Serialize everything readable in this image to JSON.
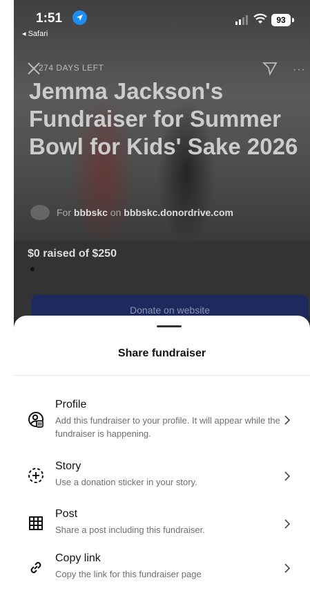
{
  "status_bar": {
    "time": "1:51",
    "back_app": "◂ Safari",
    "battery": "93"
  },
  "hero": {
    "days_left": "274 DAYS LEFT",
    "title": "Jemma Jackson's Fundraiser for Summer Bowl for Kids' Sake 2026",
    "org_prefix": "For ",
    "org_name": "bbbskc",
    "org_mid": " on ",
    "org_site": "bbbskc.donordrive.com"
  },
  "progress": {
    "raised_text": "$0 raised of $250",
    "fraction": 0
  },
  "donate_button": "Donate on website",
  "sheet": {
    "title": "Share fundraiser",
    "options": [
      {
        "icon": "profile-icon",
        "name": "Profile",
        "desc": "Add this fundraiser to your profile. It will appear while the fundraiser is happening."
      },
      {
        "icon": "story-add-icon",
        "name": "Story",
        "desc": "Use a donation sticker in your story."
      },
      {
        "icon": "grid-icon",
        "name": "Post",
        "desc": "Share a post including this fundraiser."
      },
      {
        "icon": "link-icon",
        "name": "Copy link",
        "desc": "Copy the link for this fundraiser page"
      }
    ]
  },
  "colors": {
    "accent_blue": "#1e8cf0",
    "donate_button": "#1e2a5e",
    "sheet_bg": "#ffffff"
  }
}
